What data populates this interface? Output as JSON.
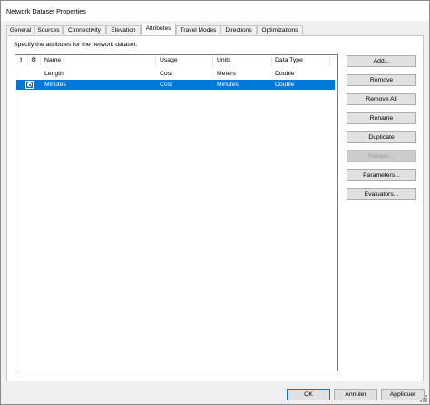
{
  "window": {
    "title": "Network Dataset Properties"
  },
  "tabs": [
    {
      "label": "General"
    },
    {
      "label": "Sources"
    },
    {
      "label": "Connectivity"
    },
    {
      "label": "Elevation"
    },
    {
      "label": "Attributes",
      "active": true
    },
    {
      "label": "Travel Modes"
    },
    {
      "label": "Directions"
    },
    {
      "label": "Optimizations"
    }
  ],
  "panel": {
    "instruction": "Specify the attributes for the network dataset:"
  },
  "table": {
    "header_icons": [
      "exclamation-icon",
      "gear-icon"
    ],
    "header_icon_glyphs": [
      "!",
      "⚙"
    ],
    "columns": [
      "Name",
      "Usage",
      "Units",
      "Data Type"
    ],
    "rows": [
      {
        "name": "Length",
        "usage": "Cost",
        "units": "Meters",
        "data_type": "Double",
        "selected": false
      },
      {
        "name": "Minutes",
        "usage": "Cost",
        "units": "Minutes",
        "data_type": "Double",
        "selected": true
      }
    ]
  },
  "buttons": {
    "add": "Add...",
    "remove": "Remove",
    "remove_all": "Remove All",
    "rename": "Rename",
    "duplicate": "Duplicate",
    "ranges": "Ranges...",
    "parameters": "Parameters...",
    "evaluators": "Evaluators..."
  },
  "footer": {
    "ok": "OK",
    "cancel": "Annuler",
    "apply": "Appliquer"
  },
  "colors": {
    "selection": "#0078d7",
    "panel": "#ffffff",
    "dialog": "#f0f0f0"
  }
}
